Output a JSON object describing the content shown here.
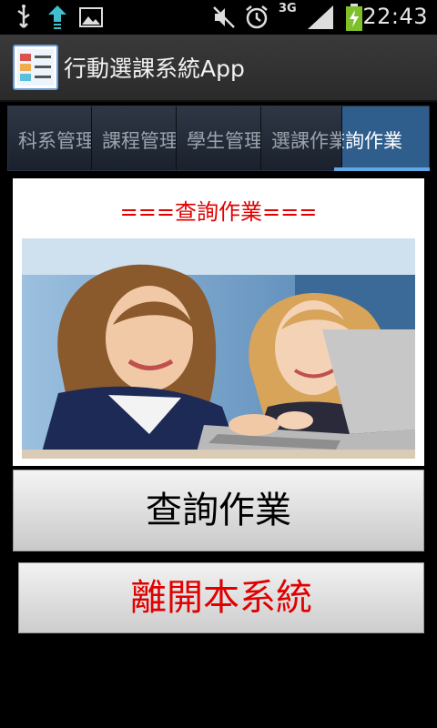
{
  "status_bar": {
    "time": "22:43",
    "network": "3G",
    "icons": [
      "usb-icon",
      "download-icon",
      "gallery-icon",
      "mute-icon",
      "alarm-icon",
      "signal-icon",
      "battery-charging-icon"
    ]
  },
  "action_bar": {
    "title": "行動選課系統App",
    "icon": "app-form-icon"
  },
  "tabs": [
    {
      "label": "科系管理",
      "active": false
    },
    {
      "label": "課程管理",
      "active": false
    },
    {
      "label": "學生管理",
      "active": false
    },
    {
      "label": "選課作業",
      "active": false
    },
    {
      "label": "查詢作業",
      "active": true
    }
  ],
  "main": {
    "title": "===查詢作業==="
  },
  "buttons": {
    "query": "查詢作業",
    "exit": "離開本系統"
  },
  "colors": {
    "accent_red": "#e00000",
    "tab_active": "#2f5d8c",
    "tab_indicator": "#5fa8e6"
  }
}
